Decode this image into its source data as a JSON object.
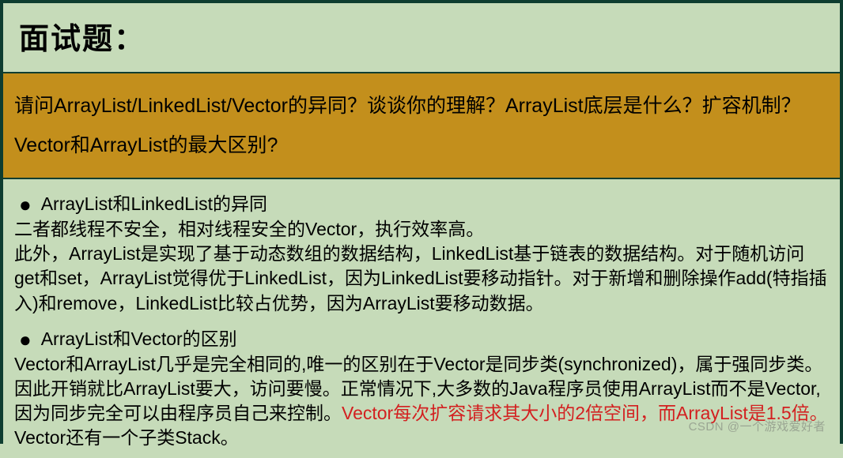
{
  "title": "面试题：",
  "question": "请问ArrayList/LinkedList/Vector的异同？谈谈你的理解？ArrayList底层是什么？扩容机制？Vector和ArrayList的最大区别?",
  "answer": {
    "bullet1_title": "ArrayList和LinkedList的异同",
    "bullet1_line1": "二者都线程不安全，相对线程安全的Vector，执行效率高。",
    "bullet1_line2": "此外，ArrayList是实现了基于动态数组的数据结构，LinkedList基于链表的数据结构。对于随机访问get和set，ArrayList觉得优于LinkedList，因为LinkedList要移动指针。对于新增和删除操作add(特指插入)和remove，LinkedList比较占优势，因为ArrayList要移动数据。",
    "bullet2_title": "ArrayList和Vector的区别",
    "bullet2_part1": "Vector和ArrayList几乎是完全相同的,唯一的区别在于Vector是同步类(synchronized)，属于强同步类。因此开销就比ArrayList要大，访问要慢。正常情况下,大多数的Java程序员使用ArrayList而不是Vector,因为同步完全可以由程序员自己来控制。",
    "bullet2_red": "Vector每次扩容请求其大小的2倍空间，而ArrayList是1.5倍。",
    "bullet2_part2": "Vector还有一个子类Stack。"
  },
  "watermark": "CSDN @一个游戏爱好者"
}
